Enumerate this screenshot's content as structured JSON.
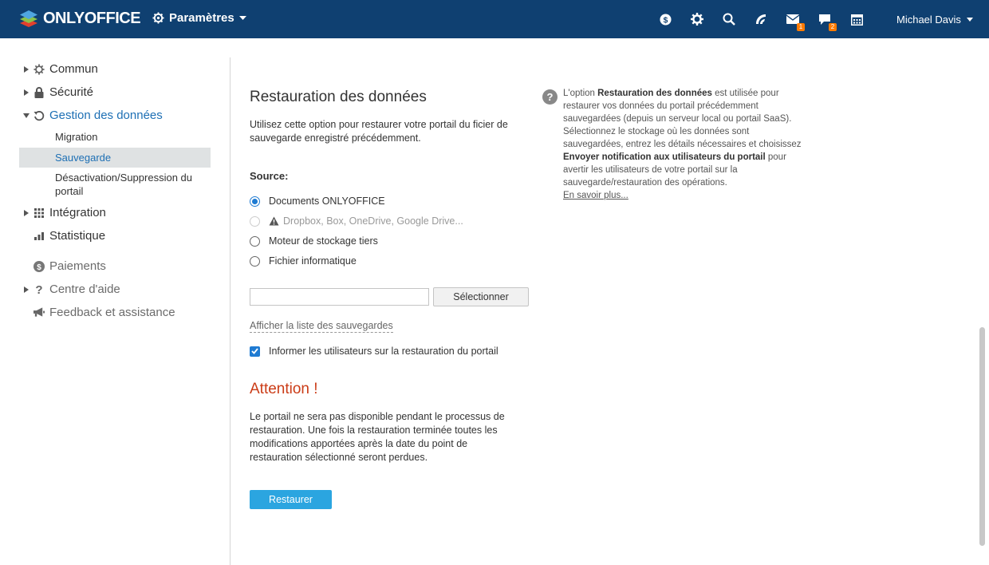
{
  "topbar": {
    "logo_text": "ONLYOFFICE",
    "module_label": "Paramètres",
    "icons": [
      "payments-icon",
      "settings-icon",
      "search-icon",
      "feed-icon",
      "mail-icon",
      "chat-icon",
      "calendar-icon"
    ],
    "mail_badge": "1",
    "chat_badge": "2",
    "user_name": "Michael Davis"
  },
  "sidebar": {
    "items": [
      {
        "label": "Commun"
      },
      {
        "label": "Sécurité"
      },
      {
        "label": "Gestion des données"
      },
      {
        "label": "Intégration"
      },
      {
        "label": "Statistique"
      },
      {
        "label": "Paiements"
      },
      {
        "label": "Centre d'aide"
      },
      {
        "label": "Feedback et assistance"
      }
    ],
    "sub_items": [
      {
        "label": "Migration"
      },
      {
        "label": "Sauvegarde"
      },
      {
        "label": "Désactivation/Suppression du portail"
      }
    ]
  },
  "main": {
    "title": "Restauration des données",
    "description": "Utilisez cette option pour restaurer votre portail du ficier de sauvegarde enregistré précédemment.",
    "source_label": "Source:",
    "sources": [
      {
        "label": "Documents ONLYOFFICE",
        "checked": true,
        "disabled": false
      },
      {
        "label": "Dropbox, Box, OneDrive, Google Drive...",
        "checked": false,
        "disabled": true
      },
      {
        "label": "Moteur de stockage tiers",
        "checked": false,
        "disabled": false
      },
      {
        "label": "Fichier informatique",
        "checked": false,
        "disabled": false
      }
    ],
    "file_input_value": "",
    "select_button": "Sélectionner",
    "backup_list_link": "Afficher la liste des sauvegardes",
    "notify_label": "Informer les utilisateurs sur la restauration du portail",
    "notify_checked": true,
    "warning_title": "Attention !",
    "warning_text": "Le portail ne sera pas disponible pendant le processus de restauration. Une fois la restauration terminée toutes les modifications apportées après la date du point de restauration sélectionné seront perdues.",
    "restore_button": "Restaurer"
  },
  "help": {
    "text_1": "L'option ",
    "bold_1": "Restauration des données",
    "text_2": " est utilisée pour restaurer vos données du portail précédemment sauvegardées (depuis un serveur local ou portail SaaS). Sélectionnez le stockage où les données sont sauvegardées, entrez les détails nécessaires et choisissez ",
    "bold_2": "Envoyer notification aux utilisateurs du portail",
    "text_3": " pour avertir les utilisateurs de votre portail sur la sauvegarde/restauration des opérations.",
    "link": "En savoir plus..."
  },
  "colors": {
    "topbar": "#0f4071",
    "accent": "#1f7bd2",
    "button": "#2ba5e0",
    "warning": "#cb3c17"
  }
}
